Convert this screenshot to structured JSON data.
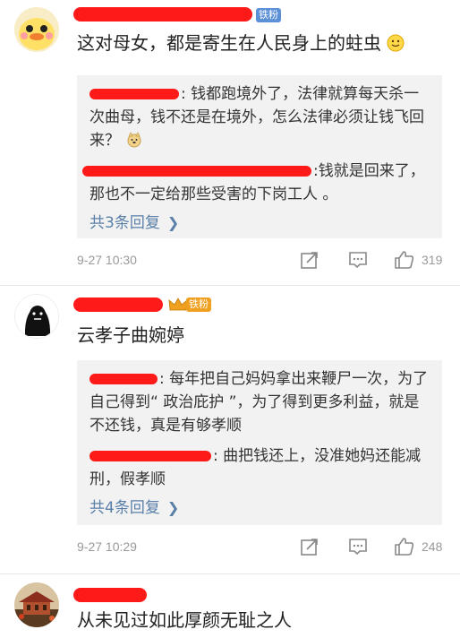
{
  "comments": [
    {
      "badge": "铁粉",
      "text": "这对母女，都是寄生在人民身上的蛀虫",
      "replies": [
        {
          "text": ": 钱都跑境外了，法律就算每天杀一次曲母，钱不还是在境外，怎么法律必须让钱飞回来？"
        },
        {
          "text": ":钱就是回来了，那也不一定给那些受害的下岗工人 。"
        }
      ],
      "more_replies": "共3条回复",
      "time": "9-27 10:30",
      "likes": "319"
    },
    {
      "badge": "铁粉",
      "text": "云孝子曲婉婷",
      "replies": [
        {
          "text": ": 每年把自己妈妈拿出来鞭尸一次，为了自己得到“ 政治庇护 ”，为了得到更多利益，就是不还钱，真是有够孝顺"
        },
        {
          "text": ": 曲把钱还上，没准她妈还能减刑，假孝顺"
        }
      ],
      "more_replies": "共4条回复",
      "time": "9-27 10:29",
      "likes": "248"
    },
    {
      "text": "从未见过如此厚颜无耻之人"
    }
  ],
  "colors": {
    "accent": "#5a7fa8",
    "redaction": "#ff1a1a",
    "badge_blue": "#5b8fd6",
    "badge_gold": "#f0a020"
  },
  "icons": [
    "share-icon",
    "comment-icon",
    "like-icon",
    "smile-emoji",
    "dog-emoji"
  ]
}
